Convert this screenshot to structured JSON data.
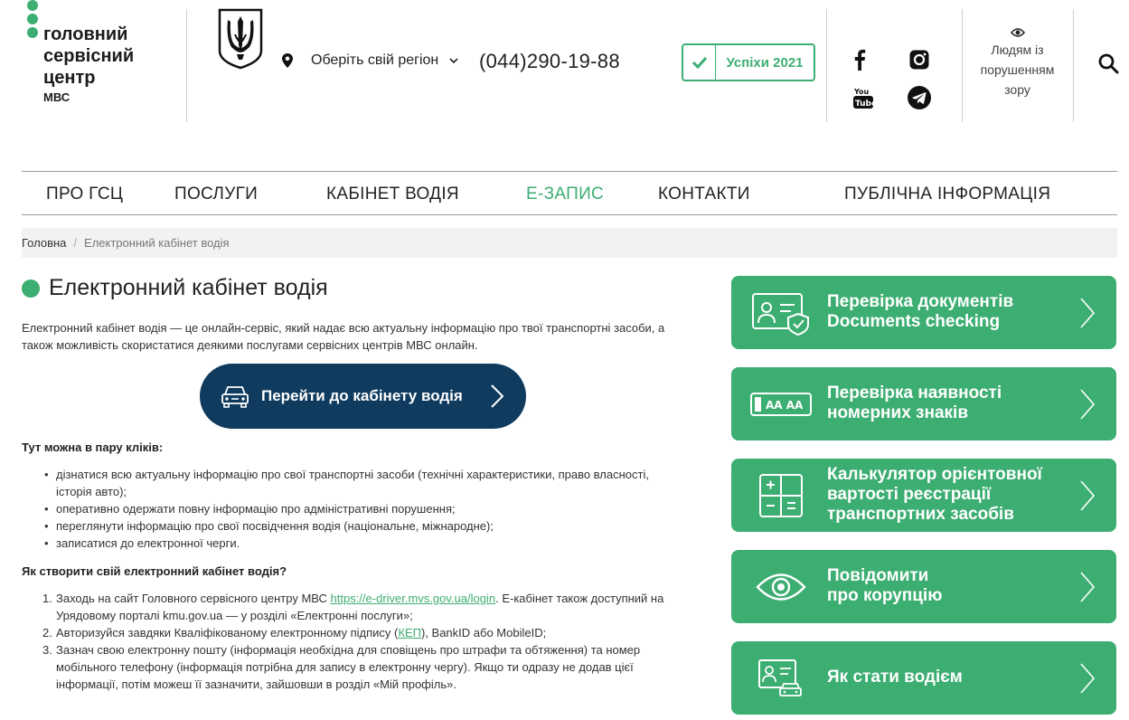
{
  "header": {
    "logo": {
      "name_lines": [
        "головний",
        "сервісний",
        "центр"
      ],
      "sub": "МВС"
    },
    "region": {
      "label": "Оберіть свій регіон"
    },
    "phone": "(044)290-19-88",
    "success_label": "Успіхи 2021",
    "vision_lines": [
      "Людям із",
      "порушенням",
      "зору"
    ],
    "icons": {
      "location": "map-pin-icon",
      "check": "check-icon",
      "facebook": "facebook-icon",
      "instagram": "instagram-icon",
      "youtube": "youtube-icon",
      "telegram": "telegram-icon",
      "eye": "eye-icon",
      "search": "search-icon"
    }
  },
  "nav": {
    "items": [
      {
        "label": "ПРО ГСЦ"
      },
      {
        "label": "ПОСЛУГИ"
      },
      {
        "label": "КАБІНЕТ ВОДІЯ"
      },
      {
        "label": "Е-ЗАПИС",
        "active": true
      },
      {
        "label": "КОНТАКТИ"
      },
      {
        "label": "ПУБЛІЧНА ІНФОРМАЦІЯ"
      }
    ]
  },
  "breadcrumb": {
    "home": "Головна",
    "separator": "/",
    "current": "Електронний кабінет водія"
  },
  "main": {
    "title": "Електронний кабінет водія",
    "intro_lines": [
      "Електронний кабінет водія — це онлайн-сервіс, який надає всю актуальну інформацію про твої транспортні засоби, а",
      "також можливість скористатися деякими послугами сервісних центрів МВС онлайн."
    ],
    "cta_label": "Перейти до кабінету водія",
    "can_do_heading": "Тут можна в пару кліків:",
    "can_do": [
      {
        "lines": [
          "дізнатися всю актуальну інформацію про свої транспортні засоби (технічні характеристики, право власності,",
          "історія авто);"
        ]
      },
      {
        "lines": [
          "оперативно одержати повну інформацію про адміністративні порушення;"
        ]
      },
      {
        "lines": [
          "переглянути інформацію про свої посвідчення водія (національне, міжнародне);"
        ]
      },
      {
        "lines": [
          "записатися до електронної черги."
        ]
      }
    ],
    "how_heading": "Як створити свій електронний кабінет водія?",
    "steps": [
      {
        "num": "1.",
        "a": "Заходь на сайт Головного сервісного центру МВС ",
        "link": "https://e-driver.mvs.gov.ua/login",
        "b": ". Е-кабінет також доступний на",
        "c": "Урядовому порталі kmu.gov.ua — у розділі «Електронні послуги»;"
      },
      {
        "num": "2.",
        "a": "Авторизуйся завдяки Кваліфікованому електронному  підпису (",
        "link": "КЕП",
        "b": "), BankID або MobileID;"
      },
      {
        "num": "3.",
        "lines": [
          "Зазнач свою електронну пошту (інформація необхідна для сповіщень про штрафи та обтяження) та номер",
          "мобільного телефону (інформація потрібна для запису в електронну чергу). Якщо ти одразу не додав цієї",
          "інформації, потім можеш її зазначити, зайшовши в розділ «Мій профіль»."
        ]
      }
    ]
  },
  "sidebar_cards": [
    {
      "icon": "id-card-shield-icon",
      "lines": [
        "Перевірка документів",
        "Documents checking"
      ]
    },
    {
      "icon": "license-plate-icon",
      "plate_text": "AA  AA",
      "lines": [
        "Перевірка наявності",
        "номерних знаків"
      ]
    },
    {
      "icon": "calculator-icon",
      "lines": [
        "Калькулятор орієнтовної",
        "вартості реєстрації",
        "транспортних засобів"
      ]
    },
    {
      "icon": "eye-icon",
      "lines": [
        "Повідомити",
        "про корупцію"
      ]
    },
    {
      "icon": "driver-license-car-icon",
      "lines": [
        "Як стати водієм"
      ]
    }
  ],
  "colors": {
    "brand_green": "#3dae72",
    "cta_navy": "#0f3b5f"
  }
}
